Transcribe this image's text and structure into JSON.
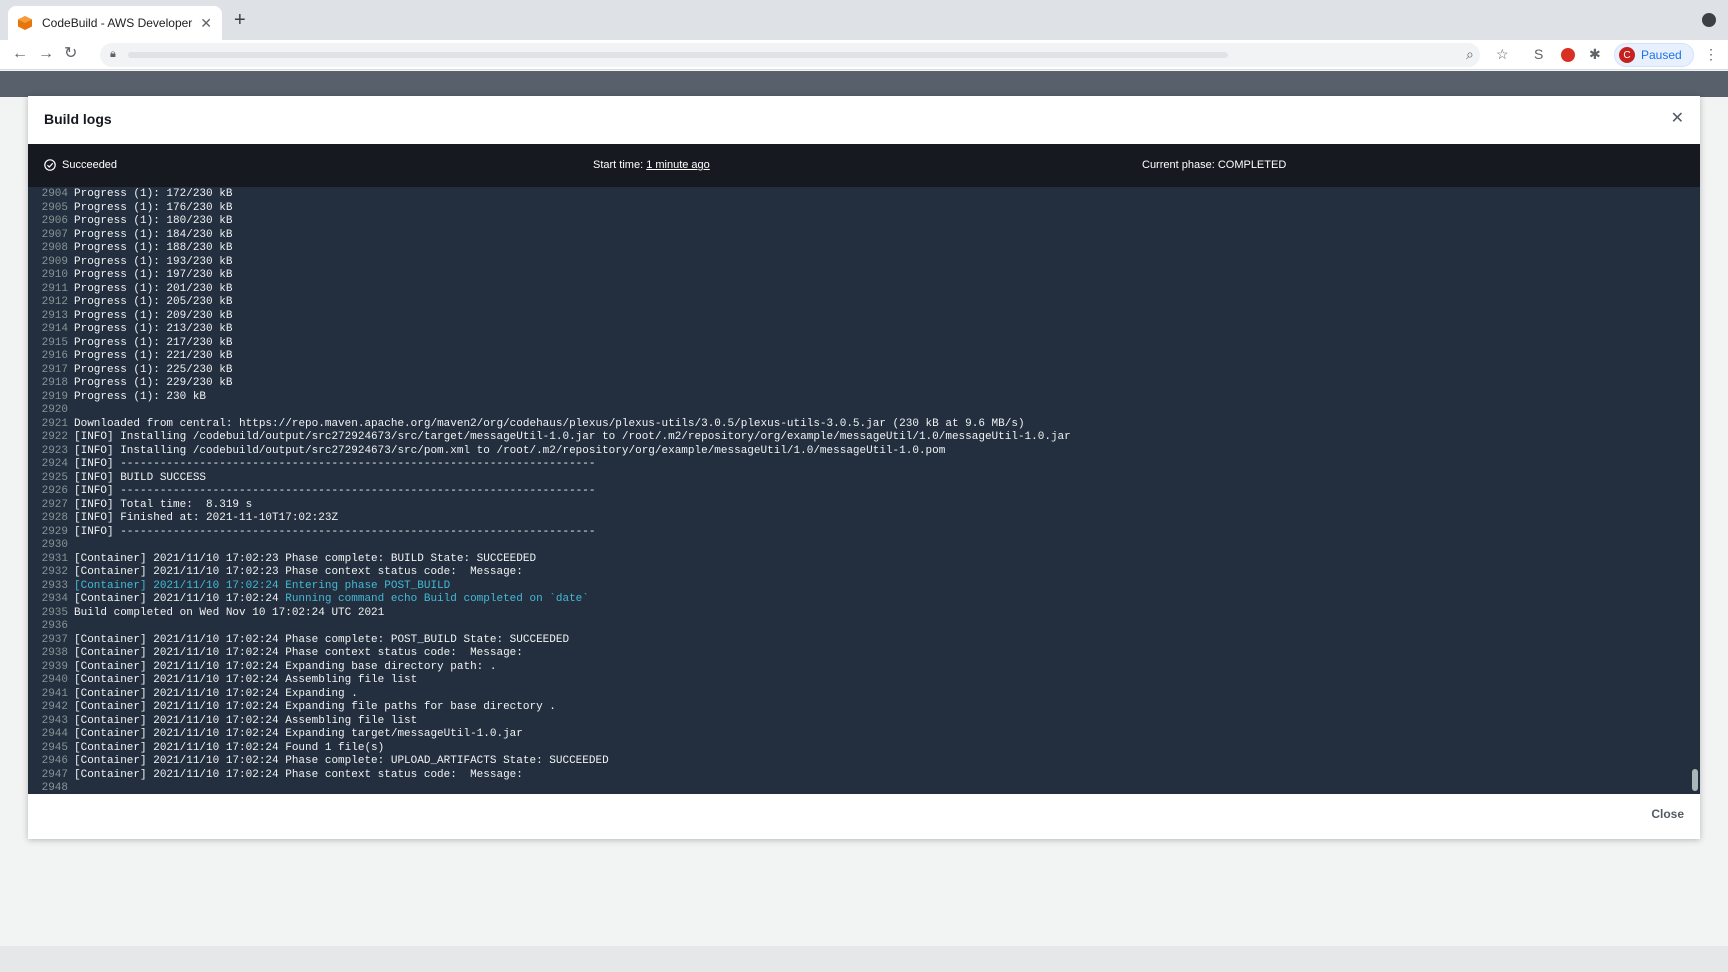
{
  "browser": {
    "tab_title": "CodeBuild - AWS Developer To",
    "tab_close": "✕",
    "new_tab": "+",
    "profile_initial": "C",
    "profile_label": "Paused"
  },
  "modal": {
    "title": "Build logs",
    "status": "Succeeded",
    "start_label": "Start time: ",
    "start_value": "1 minute ago",
    "phase": "Current phase: COMPLETED",
    "close_label": "Close"
  },
  "log": [
    {
      "n": "2904",
      "t": "Progress (1): 172/230 kB"
    },
    {
      "n": "2905",
      "t": "Progress (1): 176/230 kB"
    },
    {
      "n": "2906",
      "t": "Progress (1): 180/230 kB"
    },
    {
      "n": "2907",
      "t": "Progress (1): 184/230 kB"
    },
    {
      "n": "2908",
      "t": "Progress (1): 188/230 kB"
    },
    {
      "n": "2909",
      "t": "Progress (1): 193/230 kB"
    },
    {
      "n": "2910",
      "t": "Progress (1): 197/230 kB"
    },
    {
      "n": "2911",
      "t": "Progress (1): 201/230 kB"
    },
    {
      "n": "2912",
      "t": "Progress (1): 205/230 kB"
    },
    {
      "n": "2913",
      "t": "Progress (1): 209/230 kB"
    },
    {
      "n": "2914",
      "t": "Progress (1): 213/230 kB"
    },
    {
      "n": "2915",
      "t": "Progress (1): 217/230 kB"
    },
    {
      "n": "2916",
      "t": "Progress (1): 221/230 kB"
    },
    {
      "n": "2917",
      "t": "Progress (1): 225/230 kB"
    },
    {
      "n": "2918",
      "t": "Progress (1): 229/230 kB"
    },
    {
      "n": "2919",
      "t": "Progress (1): 230 kB"
    },
    {
      "n": "2920",
      "t": ""
    },
    {
      "n": "2921",
      "t": "Downloaded from central: ",
      "link": "https://repo.maven.apache.org/maven2/org/codehaus/plexus/plexus-utils/3.0.5/plexus-utils-3.0.5.jar",
      "after": " (230 kB at 9.6 MB/s)"
    },
    {
      "n": "2922",
      "t": "[INFO] Installing /codebuild/output/src272924673/src/target/messageUtil-1.0.jar to /root/.m2/repository/org/example/messageUtil/1.0/messageUtil-1.0.jar"
    },
    {
      "n": "2923",
      "t": "[INFO] Installing /codebuild/output/src272924673/src/pom.xml to /root/.m2/repository/org/example/messageUtil/1.0/messageUtil-1.0.pom"
    },
    {
      "n": "2924",
      "t": "[INFO] ------------------------------------------------------------------------"
    },
    {
      "n": "2925",
      "t": "[INFO] BUILD SUCCESS"
    },
    {
      "n": "2926",
      "t": "[INFO] ------------------------------------------------------------------------"
    },
    {
      "n": "2927",
      "t": "[INFO] Total time:  8.319 s"
    },
    {
      "n": "2928",
      "t": "[INFO] Finished at: 2021-11-10T17:02:23Z"
    },
    {
      "n": "2929",
      "t": "[INFO] ------------------------------------------------------------------------"
    },
    {
      "n": "2930",
      "t": ""
    },
    {
      "n": "2931",
      "t": "[Container] 2021/11/10 17:02:23 Phase complete: BUILD State: SUCCEEDED"
    },
    {
      "n": "2932",
      "t": "[Container] 2021/11/10 17:02:23 Phase context status code:  Message:"
    },
    {
      "n": "2933",
      "t": "[Container] 2021/11/10 17:02:24 Entering phase POST_BUILD",
      "hl": true
    },
    {
      "n": "2934",
      "t": "[Container] 2021/11/10 17:02:24 ",
      "hl_after": "Running command echo Build completed on `date`"
    },
    {
      "n": "2935",
      "t": "Build completed on Wed Nov 10 17:02:24 UTC 2021"
    },
    {
      "n": "2936",
      "t": ""
    },
    {
      "n": "2937",
      "t": "[Container] 2021/11/10 17:02:24 Phase complete: POST_BUILD State: SUCCEEDED"
    },
    {
      "n": "2938",
      "t": "[Container] 2021/11/10 17:02:24 Phase context status code:  Message:"
    },
    {
      "n": "2939",
      "t": "[Container] 2021/11/10 17:02:24 Expanding base directory path: ."
    },
    {
      "n": "2940",
      "t": "[Container] 2021/11/10 17:02:24 Assembling file list"
    },
    {
      "n": "2941",
      "t": "[Container] 2021/11/10 17:02:24 Expanding ."
    },
    {
      "n": "2942",
      "t": "[Container] 2021/11/10 17:02:24 Expanding file paths for base directory ."
    },
    {
      "n": "2943",
      "t": "[Container] 2021/11/10 17:02:24 Assembling file list"
    },
    {
      "n": "2944",
      "t": "[Container] 2021/11/10 17:02:24 Expanding target/messageUtil-1.0.jar"
    },
    {
      "n": "2945",
      "t": "[Container] 2021/11/10 17:02:24 Found 1 file(s)"
    },
    {
      "n": "2946",
      "t": "[Container] 2021/11/10 17:02:24 Phase complete: UPLOAD_ARTIFACTS State: SUCCEEDED"
    },
    {
      "n": "2947",
      "t": "[Container] 2021/11/10 17:02:24 Phase context status code:  Message:"
    },
    {
      "n": "2948",
      "t": ""
    }
  ]
}
